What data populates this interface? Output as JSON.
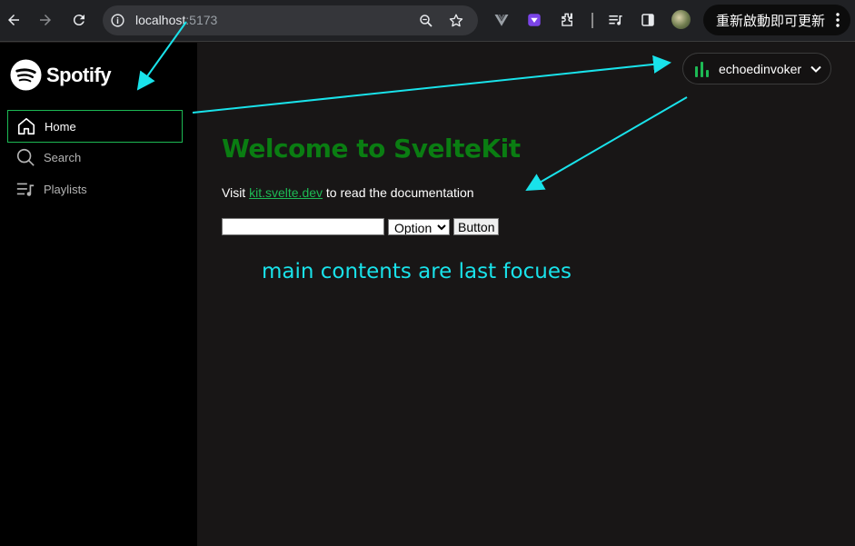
{
  "browser": {
    "url_host": "localhost",
    "url_port": ":5173",
    "update_label": "重新啟動即可更新"
  },
  "sidebar": {
    "brand": "Spotify",
    "items": [
      {
        "label": "Home",
        "icon": "home-icon",
        "active": true
      },
      {
        "label": "Search",
        "icon": "search-icon",
        "active": false
      },
      {
        "label": "Playlists",
        "icon": "playlists-icon",
        "active": false
      }
    ]
  },
  "user_menu": {
    "username": "echoedinvoker"
  },
  "main": {
    "title": "Welcome to SvelteKit",
    "visit_prefix": "Visit ",
    "visit_link": "kit.svelte.dev",
    "visit_suffix": " to read the documentation",
    "select_value": "Option",
    "button_label": "Button"
  },
  "annotation": {
    "text": "main contents are last focues"
  },
  "colors": {
    "accent": "#1db954",
    "title": "#0a7d12",
    "annotation": "#19e2ea",
    "sidebar_bg": "#000000",
    "main_bg": "#181616"
  }
}
